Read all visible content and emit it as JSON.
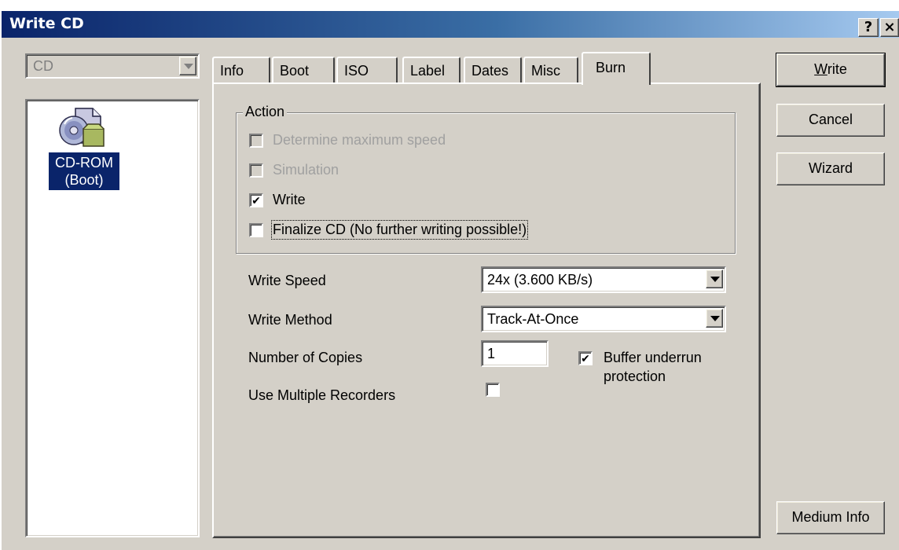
{
  "window": {
    "title": "Write CD",
    "help_button": "?",
    "close_button": "×"
  },
  "drive_select": {
    "value": "CD"
  },
  "tree": {
    "item_label_line1": "CD-ROM",
    "item_label_line2": "(Boot)",
    "item_icon": "cd-rom-icon"
  },
  "tabs": [
    {
      "label": "Info"
    },
    {
      "label": "Boot"
    },
    {
      "label": "ISO"
    },
    {
      "label": "Label"
    },
    {
      "label": "Dates"
    },
    {
      "label": "Misc"
    },
    {
      "label": "Burn",
      "active": true
    }
  ],
  "action_group": {
    "legend": "Action",
    "checkboxes": [
      {
        "label": "Determine maximum speed",
        "checked": false,
        "enabled": false
      },
      {
        "label": "Simulation",
        "checked": false,
        "enabled": false
      },
      {
        "label": "Write",
        "checked": true,
        "enabled": true
      },
      {
        "label": "Finalize CD (No further writing possible!)",
        "checked": false,
        "enabled": true
      }
    ]
  },
  "write_speed": {
    "label": "Write Speed",
    "value": "24x (3.600 KB/s)"
  },
  "write_method": {
    "label": "Write Method",
    "value": "Track-At-Once"
  },
  "copies": {
    "label": "Number of Copies",
    "value": "1"
  },
  "buffer_underrun": {
    "label_line1": "Buffer underrun",
    "label_line2": "protection",
    "checked": true
  },
  "multiple_recorders": {
    "label": "Use Multiple Recorders",
    "checked": false
  },
  "buttons": {
    "write_mnemonic": "W",
    "write_rest": "rite",
    "cancel": "Cancel",
    "wizard": "Wizard",
    "medium_info": "Medium Info"
  },
  "colors": {
    "title_bar_start": "#0a246a",
    "title_bar_end": "#a6caf0",
    "dialog_face": "#d4d0c8",
    "selection": "#0a246a"
  }
}
